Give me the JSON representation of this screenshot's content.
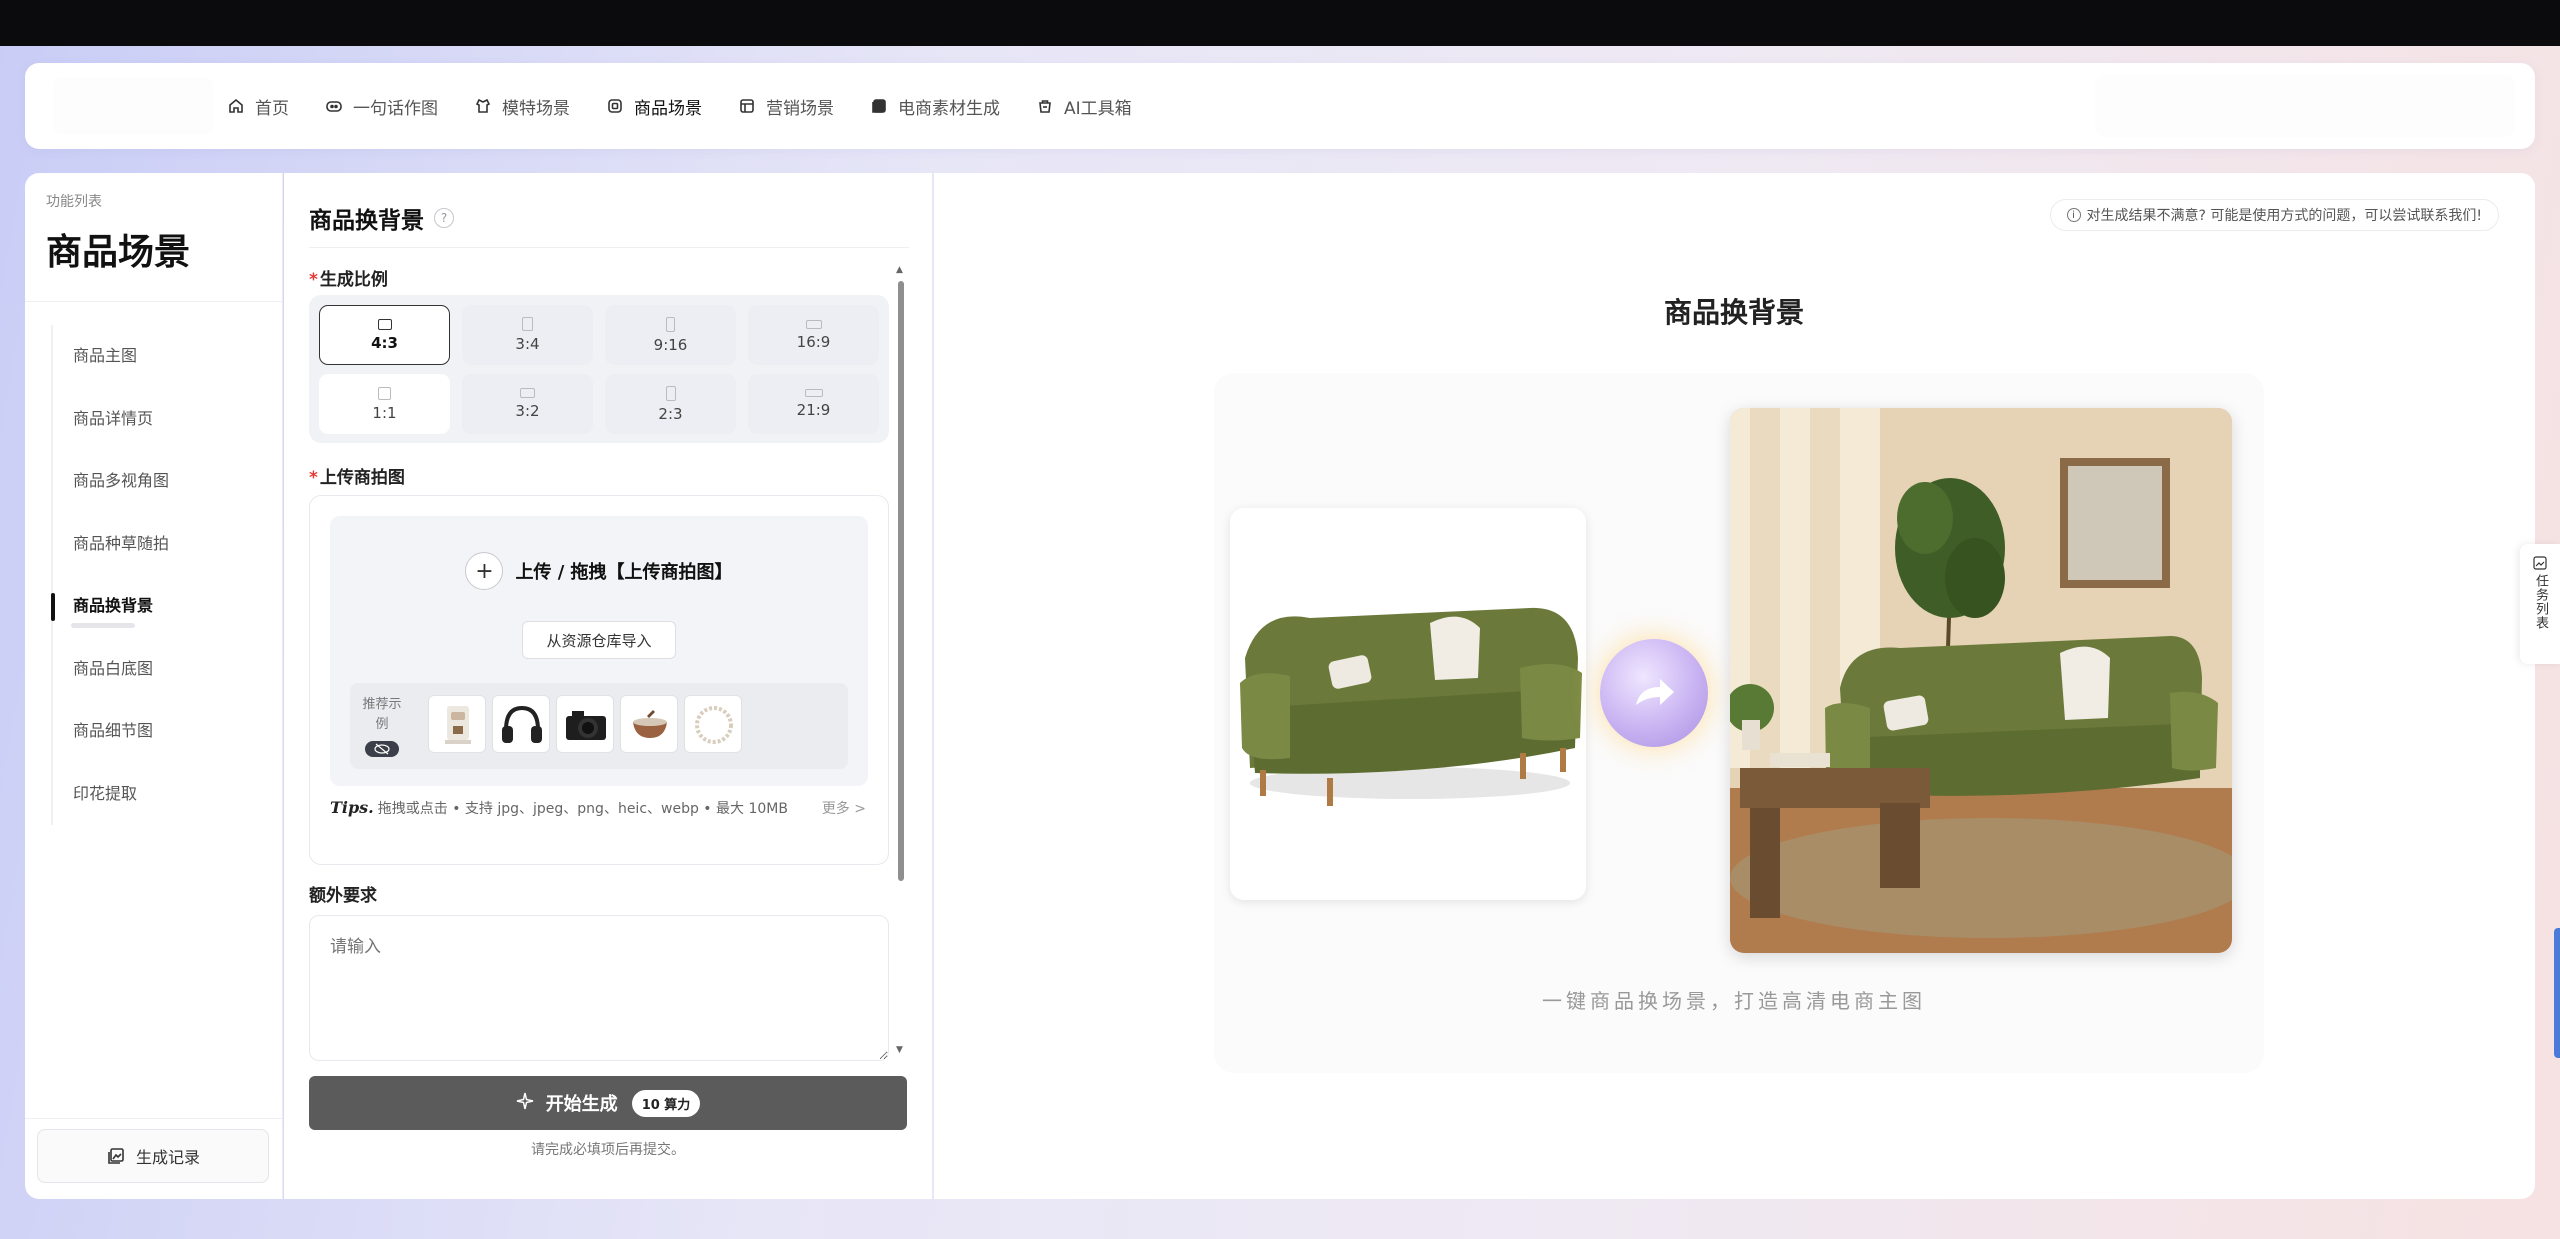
{
  "nav": {
    "items": [
      {
        "label": "首页",
        "icon": "home-icon"
      },
      {
        "label": "一句话作图",
        "icon": "chat-icon"
      },
      {
        "label": "模特场景",
        "icon": "model-icon"
      },
      {
        "label": "商品场景",
        "icon": "product-icon",
        "active": true
      },
      {
        "label": "营销场景",
        "icon": "marketing-icon"
      },
      {
        "label": "电商素材生成",
        "icon": "material-icon"
      },
      {
        "label": "AI工具箱",
        "icon": "toolbox-icon"
      }
    ]
  },
  "sidebar": {
    "caption": "功能列表",
    "title": "商品场景",
    "items": [
      {
        "label": "商品主图"
      },
      {
        "label": "商品详情页"
      },
      {
        "label": "商品多视角图"
      },
      {
        "label": "商品种草随拍"
      },
      {
        "label": "商品换背景",
        "active": true
      },
      {
        "label": "商品白底图"
      },
      {
        "label": "商品细节图"
      },
      {
        "label": "印花提取"
      }
    ],
    "history_button": "生成记录"
  },
  "panel": {
    "title": "商品换背景",
    "help": "?",
    "ratio_label": "生成比例",
    "required_mark": "*",
    "ratios": [
      "4:3",
      "3:4",
      "9:16",
      "16:9",
      "1:1",
      "3:2",
      "2:3",
      "21:9"
    ],
    "selected_ratio": "4:3",
    "upload_label": "上传商拍图",
    "upload_text": "上传 / 拖拽【上传商拍图】",
    "import_button": "从资源仓库导入",
    "samples_label": "推荐示例",
    "samples": [
      "coffee-machine",
      "headphones",
      "camera",
      "bowl",
      "necklace"
    ],
    "tips_prefix": "Tips.",
    "tips_text": "拖拽或点击 • 支持 jpg、jpeg、png、heic、webp • 最大 10MB",
    "more": "更多 >",
    "extra_label": "额外要求",
    "extra_placeholder": "请输入",
    "generate_button": "开始生成",
    "cost": "10 算力",
    "generate_hint": "请完成必填项后再提交。"
  },
  "right": {
    "notice": "对生成结果不满意? 可能是使用方式的问题，可以尝试联系我们!",
    "demo_title": "商品换背景",
    "demo_caption": "一键商品换场景，打造高清电商主图"
  },
  "task_tab": {
    "label": "任务列表"
  },
  "colors": {
    "generate_button": "#5b5b5b",
    "required": "#e53935",
    "arrow_circle": "#c9b3f2",
    "sofa": "#6e7a3a"
  }
}
